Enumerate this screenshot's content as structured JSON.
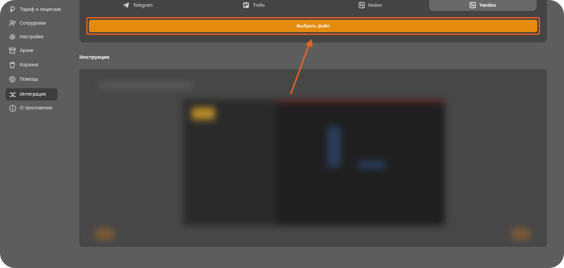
{
  "sidebar": {
    "items": [
      {
        "label": "Тариф и лицензия",
        "icon": "coin-icon",
        "active": false
      },
      {
        "label": "Сотрудники",
        "icon": "users-icon",
        "active": false
      },
      {
        "label": "Настройки",
        "icon": "gear-icon",
        "active": false
      },
      {
        "label": "Архив",
        "icon": "archive-icon",
        "active": false
      },
      {
        "label": "Корзина",
        "icon": "trash-icon",
        "active": false
      },
      {
        "label": "Помощь",
        "icon": "lifebuoy-icon",
        "active": false
      },
      {
        "label": "Интеграция",
        "icon": "integration-icon",
        "active": true
      },
      {
        "label": "О приложении",
        "icon": "info-icon",
        "active": false
      }
    ]
  },
  "tabs": [
    {
      "label": "Telegram",
      "icon": "telegram-icon",
      "active": false
    },
    {
      "label": "Trello",
      "icon": "trello-icon",
      "active": false
    },
    {
      "label": "Notion",
      "icon": "notion-icon",
      "active": false
    },
    {
      "label": "Yandex",
      "icon": "yandex-icon",
      "active": true
    }
  ],
  "file_button_label": "Выбрать файл",
  "instruction_title": "Инструкция",
  "colors": {
    "accent": "#e58b10",
    "highlight": "#e25d1a"
  }
}
